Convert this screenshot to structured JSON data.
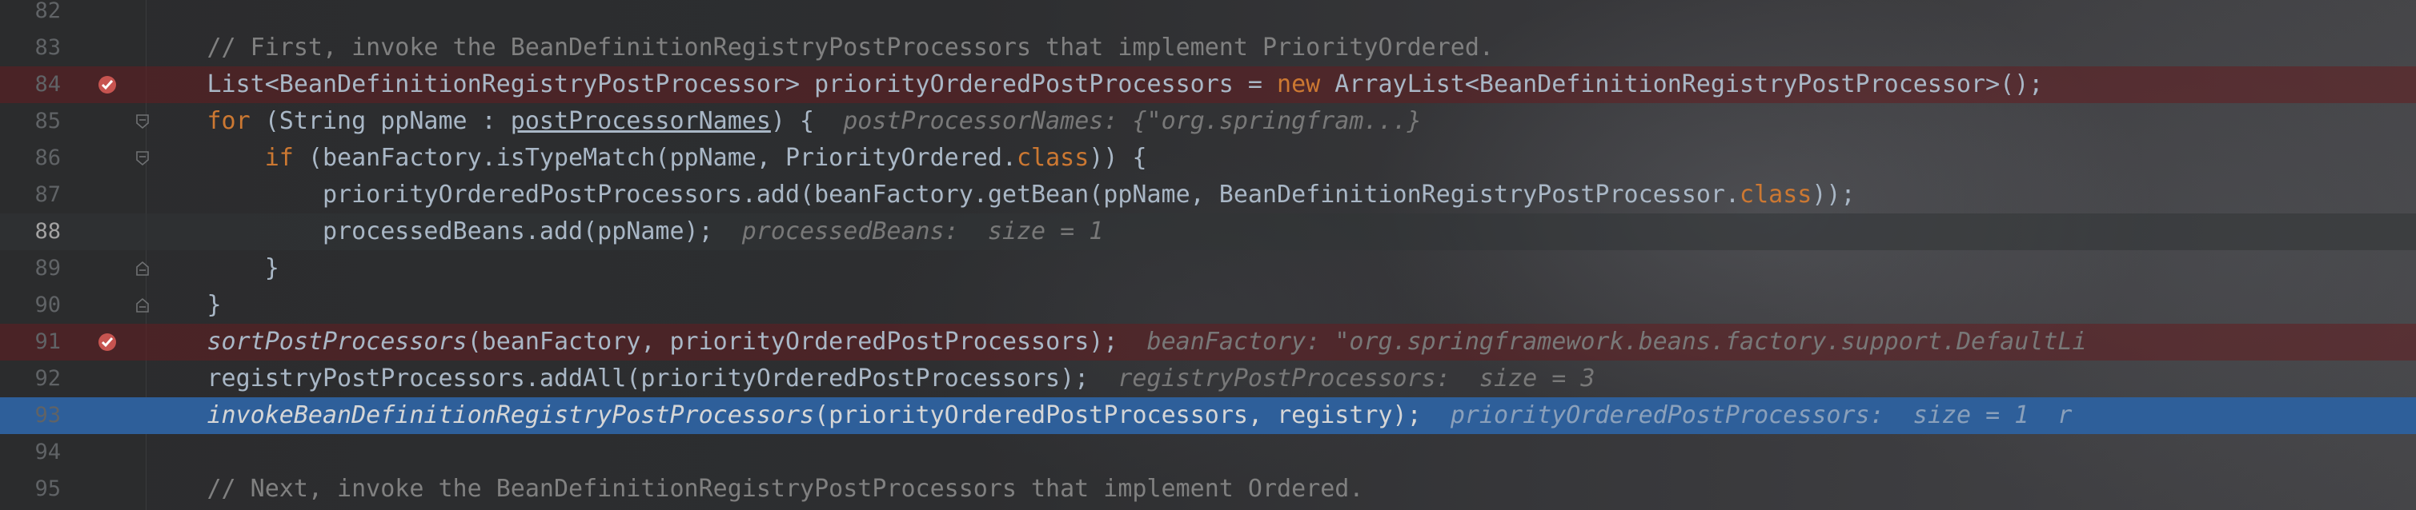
{
  "editor": {
    "lines": [
      {
        "num": "82",
        "text": "",
        "active": false
      },
      {
        "num": "83",
        "active": false,
        "segments": [
          {
            "t": "        // First, invoke the BeanDefinitionRegistryPostProcessors that implement PriorityOrdered.",
            "c": "cm"
          }
        ]
      },
      {
        "num": "84",
        "active": false,
        "segments": [
          {
            "t": "        List<BeanDefinitionRegistryPostProcessor> priorityOrderedPostProcessors = ",
            "c": ""
          },
          {
            "t": "new",
            "c": "kw"
          },
          {
            "t": " ArrayList<BeanDefinitionRegistryPostProcessor>();",
            "c": ""
          }
        ]
      },
      {
        "num": "85",
        "active": false,
        "segments": [
          {
            "t": "        ",
            "c": ""
          },
          {
            "t": "for",
            "c": "kw"
          },
          {
            "t": " (String ppName : ",
            "c": ""
          },
          {
            "t": "postProcessorNames",
            "c": "ul"
          },
          {
            "t": ") {  ",
            "c": ""
          },
          {
            "t": "postProcessorNames: {\"org.springfram...}",
            "c": "hint"
          }
        ]
      },
      {
        "num": "86",
        "active": false,
        "segments": [
          {
            "t": "            ",
            "c": ""
          },
          {
            "t": "if",
            "c": "kw"
          },
          {
            "t": " (beanFactory.isTypeMatch(ppName, PriorityOrdered.",
            "c": ""
          },
          {
            "t": "class",
            "c": "kw"
          },
          {
            "t": ")) {",
            "c": ""
          }
        ]
      },
      {
        "num": "87",
        "active": false,
        "segments": [
          {
            "t": "                priorityOrderedPostProcessors.add(beanFactory.getBean(ppName, BeanDefinitionRegistryPostProcessor.",
            "c": ""
          },
          {
            "t": "class",
            "c": "kw"
          },
          {
            "t": "));",
            "c": ""
          }
        ]
      },
      {
        "num": "88",
        "active": true,
        "segments": [
          {
            "t": "                processedBeans.add(ppName);  ",
            "c": ""
          },
          {
            "t": "processedBeans:  size = 1",
            "c": "hint"
          }
        ]
      },
      {
        "num": "89",
        "active": false,
        "segments": [
          {
            "t": "            }",
            "c": ""
          }
        ]
      },
      {
        "num": "90",
        "active": false,
        "segments": [
          {
            "t": "        }",
            "c": ""
          }
        ]
      },
      {
        "num": "91",
        "active": false,
        "segments": [
          {
            "t": "        ",
            "c": ""
          },
          {
            "t": "sortPostProcessors",
            "c": "it"
          },
          {
            "t": "(beanFactory, priorityOrderedPostProcessors);  ",
            "c": ""
          },
          {
            "t": "beanFactory: \"org.springframework.beans.factory.support.DefaultLi",
            "c": "hint"
          }
        ]
      },
      {
        "num": "92",
        "active": false,
        "segments": [
          {
            "t": "        registryPostProcessors.addAll(priorityOrderedPostProcessors);  ",
            "c": ""
          },
          {
            "t": "registryPostProcessors:  size = 3",
            "c": "hint"
          }
        ]
      },
      {
        "num": "93",
        "active": false,
        "segments": [
          {
            "t": "        ",
            "c": ""
          },
          {
            "t": "invokeBeanDefinitionRegistryPostProcessors",
            "c": "it"
          },
          {
            "t": "(priorityOrderedPostProcessors, registry);  ",
            "c": ""
          },
          {
            "t": "priorityOrderedPostProcessors:  size = 1  r",
            "c": "hint"
          }
        ]
      },
      {
        "num": "94",
        "text": "",
        "active": false
      },
      {
        "num": "95",
        "active": false,
        "segments": [
          {
            "t": "        // Next, invoke the BeanDefinitionRegistryPostProcessors that implement Ordered.",
            "c": "cm"
          }
        ]
      }
    ],
    "breakpoint_lines": [
      "84",
      "91"
    ],
    "current_line": "93",
    "fold_lines": [
      "85",
      "86",
      "89",
      "90"
    ],
    "colors": {
      "keyword": "#cc7832",
      "comment": "#808080",
      "text": "#a9b7c6",
      "breakpoint_row": "#5a1e20",
      "current_row": "#2e5f9a",
      "breakpoint_icon": "#c75450"
    }
  }
}
